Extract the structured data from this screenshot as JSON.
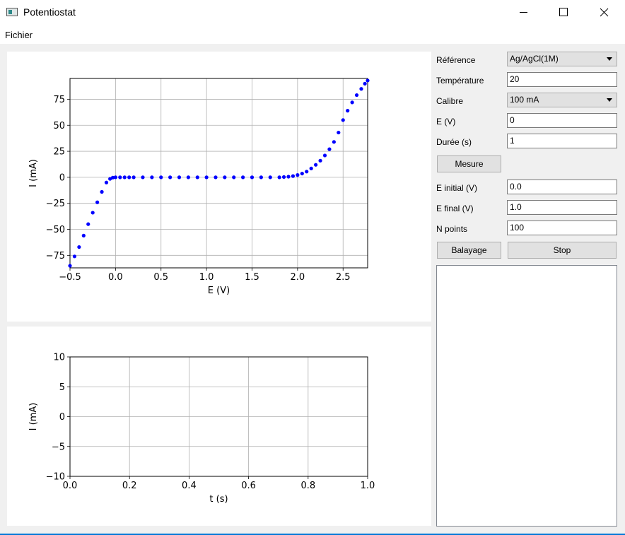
{
  "window": {
    "title": "Potentiostat"
  },
  "menu": {
    "fichier": "Fichier"
  },
  "controls": {
    "reference": {
      "label": "Référence",
      "value": "Ag/AgCl(1M)"
    },
    "temperature": {
      "label": "Température",
      "value": "20"
    },
    "calibre": {
      "label": "Calibre",
      "value": "100 mA"
    },
    "e": {
      "label": "E (V)",
      "value": "0"
    },
    "duree": {
      "label": "Durée (s)",
      "value": "1"
    },
    "mesure_button": "Mesure",
    "e_initial": {
      "label": "E initial (V)",
      "value": "0.0"
    },
    "e_final": {
      "label": "E final (V)",
      "value": "1.0"
    },
    "n_points": {
      "label": "N points",
      "value": "100"
    },
    "balayage_button": "Balayage",
    "stop_button": "Stop"
  },
  "chart_data": [
    {
      "type": "scatter",
      "xlabel": "E (V)",
      "ylabel": "I (mA)",
      "xlim": [
        -0.5,
        2.77
      ],
      "ylim": [
        -87,
        95
      ],
      "xticks": [
        -0.5,
        0.0,
        0.5,
        1.0,
        1.5,
        2.0,
        2.5
      ],
      "xtick_labels": [
        "−0.5",
        "0.0",
        "0.5",
        "1.0",
        "1.5",
        "2.0",
        "2.5"
      ],
      "yticks": [
        -75,
        -50,
        -25,
        0,
        25,
        50,
        75
      ],
      "ytick_labels": [
        "−75",
        "−50",
        "−25",
        "0",
        "25",
        "50",
        "75"
      ],
      "grid": true,
      "marker_color": "#0000ff",
      "series": [
        {
          "x": [
            -0.5,
            -0.45,
            -0.4,
            -0.35,
            -0.3,
            -0.25,
            -0.2,
            -0.15,
            -0.1,
            -0.06,
            -0.03,
            0.0,
            0.05,
            0.1,
            0.15,
            0.2,
            0.3,
            0.4,
            0.5,
            0.6,
            0.7,
            0.8,
            0.9,
            1.0,
            1.1,
            1.2,
            1.3,
            1.4,
            1.5,
            1.6,
            1.7,
            1.8,
            1.85,
            1.9,
            1.95,
            2.0,
            2.05,
            2.1,
            2.15,
            2.2,
            2.25,
            2.3,
            2.35,
            2.4,
            2.45,
            2.5,
            2.55,
            2.6,
            2.65,
            2.7,
            2.74,
            2.77
          ],
          "y": [
            -85,
            -76,
            -67,
            -56,
            -45,
            -34,
            -24,
            -14,
            -5,
            -1.5,
            -0.3,
            0,
            0,
            0,
            0,
            0,
            0,
            0,
            0,
            0,
            0,
            0,
            0,
            0,
            0,
            0,
            0,
            0,
            0,
            0,
            0,
            0,
            0.3,
            0.6,
            1.2,
            2.2,
            3.6,
            5.5,
            8.5,
            12,
            16,
            21,
            27,
            34,
            43,
            55,
            64,
            72,
            79,
            85,
            90,
            93
          ]
        }
      ]
    },
    {
      "type": "line",
      "xlabel": "t (s)",
      "ylabel": "I (mA)",
      "xlim": [
        0.0,
        1.0
      ],
      "ylim": [
        -10,
        10
      ],
      "xticks": [
        0.0,
        0.2,
        0.4,
        0.6,
        0.8,
        1.0
      ],
      "xtick_labels": [
        "0.0",
        "0.2",
        "0.4",
        "0.6",
        "0.8",
        "1.0"
      ],
      "yticks": [
        -10,
        -5,
        0,
        5,
        10
      ],
      "ytick_labels": [
        "−10",
        "−5",
        "0",
        "5",
        "10"
      ],
      "grid": true,
      "series": []
    }
  ]
}
